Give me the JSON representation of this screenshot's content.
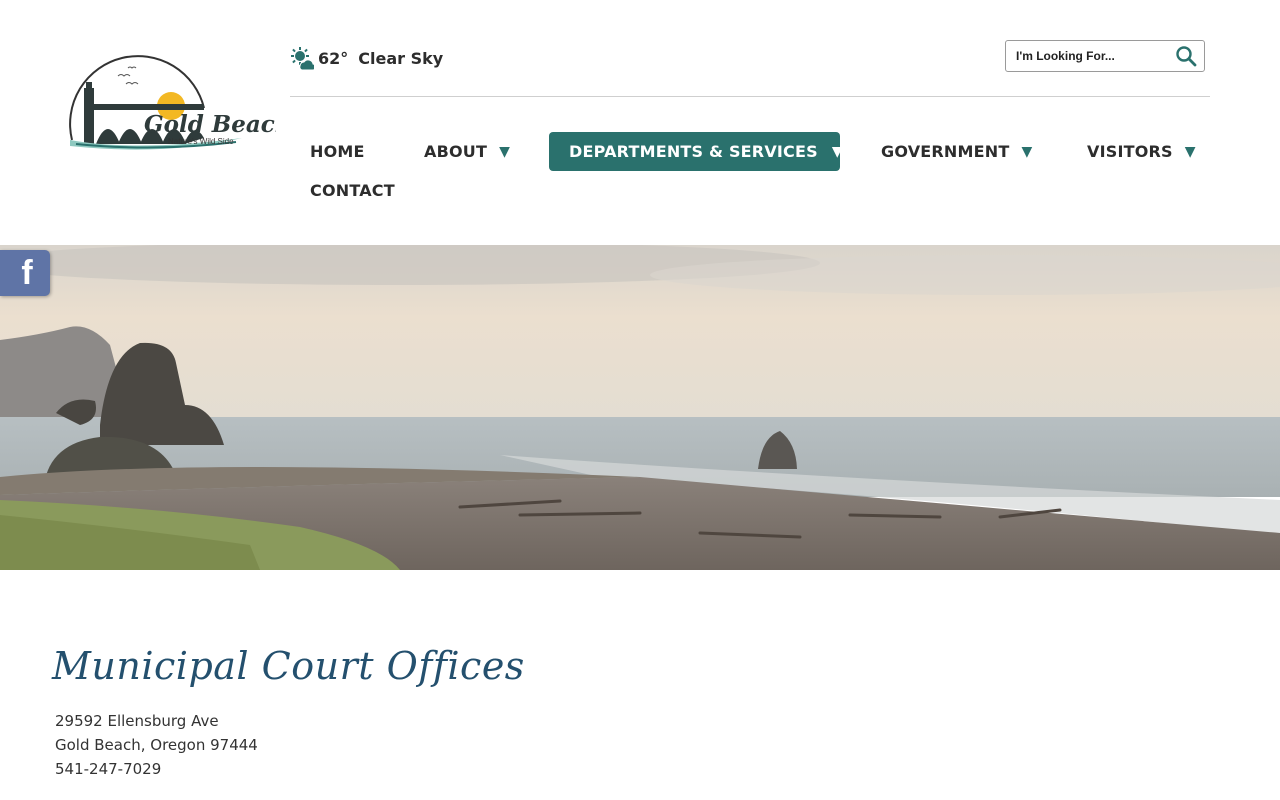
{
  "header": {
    "logo": {
      "name": "Gold Beach",
      "tagline": "Nature's Wild Side"
    },
    "weather": {
      "icon": "partly-sunny-icon",
      "temperature": "62°",
      "condition": "Clear Sky"
    },
    "search": {
      "placeholder": "I'm Looking For...",
      "value": "",
      "icon": "search-icon"
    }
  },
  "nav": {
    "items": [
      {
        "label": "HOME",
        "has_dropdown": false
      },
      {
        "label": "ABOUT",
        "has_dropdown": true
      },
      {
        "label": "DEPARTMENTS & SERVICES",
        "has_dropdown": true,
        "active": true
      },
      {
        "label": "GOVERNMENT",
        "has_dropdown": true
      },
      {
        "label": "VISITORS",
        "has_dropdown": true
      },
      {
        "label": "CONTACT",
        "has_dropdown": false
      }
    ],
    "caret": "▼"
  },
  "social": {
    "facebook_glyph": "f",
    "icon": "facebook-icon"
  },
  "main": {
    "title": "Municipal Court Offices",
    "address": {
      "street": "29592 Ellensburg Ave",
      "city_state_zip": "Gold Beach, Oregon 97444",
      "phone": "541-247-7029"
    }
  },
  "colors": {
    "accent": "#2a716d",
    "title": "#24506e",
    "facebook": "#5f74a6",
    "text": "#333333"
  }
}
